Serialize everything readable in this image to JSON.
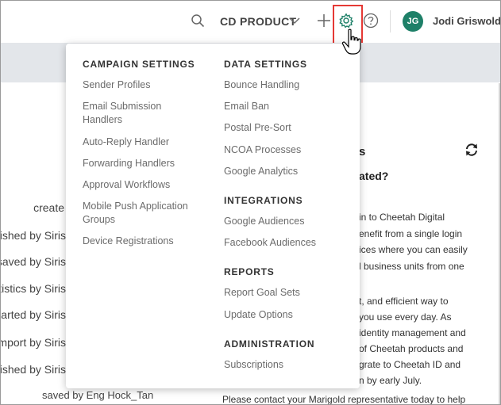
{
  "header": {
    "product_label": "CD PRODUCT",
    "avatar_initials": "JG",
    "user_name": "Jodi Griswold",
    "avatar_color": "#1e8068",
    "highlight_color": "#e53935"
  },
  "background": {
    "left_fragments": [
      "create",
      "lished by Siris",
      "saved by Siris",
      "tistics by Siris",
      "tarted by Siris",
      "mport by Siris",
      "lished by Siris"
    ],
    "bottom_left": "saved by Eng Hock_Tan",
    "card_title_fragment": "s",
    "card_question_fragment": "ated?",
    "card_lines": [
      "in to Cheetah Digital",
      "enefit from a single login",
      "ices where you can easily",
      "l business units from one",
      "",
      "t, and efficient way to",
      "you use every day. As",
      "identity management and",
      "of Cheetah products and",
      "grate to Cheetah ID and",
      "n by early July."
    ],
    "bottom_note": "Please contact your Marigold representative today to help"
  },
  "menu": {
    "left": [
      {
        "heading": "CAMPAIGN SETTINGS",
        "items": [
          "Sender Profiles",
          "Email Submission Handlers",
          "Auto-Reply Handler",
          "Forwarding Handlers",
          "Approval Workflows",
          "Mobile Push Application Groups",
          "Device Registrations"
        ]
      }
    ],
    "right": [
      {
        "heading": "DATA SETTINGS",
        "items": [
          "Bounce Handling",
          "Email Ban",
          "Postal Pre-Sort",
          "NCOA Processes",
          "Google Analytics"
        ]
      },
      {
        "heading": "INTEGRATIONS",
        "items": [
          "Google Audiences",
          "Facebook Audiences"
        ]
      },
      {
        "heading": "REPORTS",
        "items": [
          "Report Goal Sets",
          "Update Options"
        ]
      },
      {
        "heading": "ADMINISTRATION",
        "items": [
          "Subscriptions"
        ]
      }
    ]
  }
}
